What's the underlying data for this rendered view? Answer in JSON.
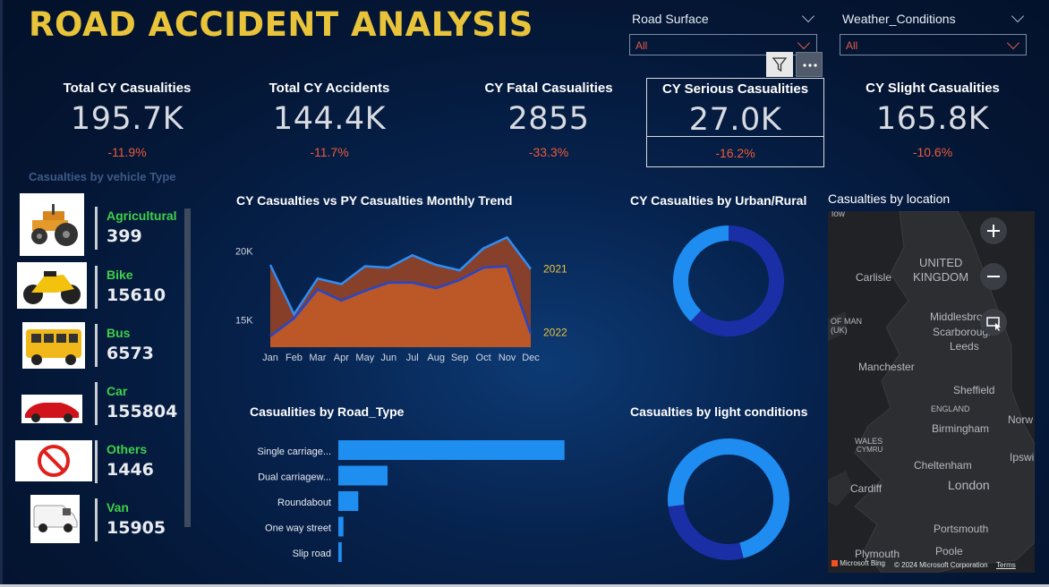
{
  "title": "ROAD ACCIDENT ANALYSIS",
  "slicers": [
    {
      "label": "Road Surface",
      "value": "All"
    },
    {
      "label": "Weather_Conditions",
      "value": "All"
    }
  ],
  "kpis": [
    {
      "title": "Total CY Casualities",
      "value": "195.7K",
      "change": "-11.9%"
    },
    {
      "title": "Total CY Accidents",
      "value": "144.4K",
      "change": "-11.7%"
    },
    {
      "title": "CY Fatal Casualities",
      "value": "2855",
      "change": "-33.3%"
    },
    {
      "title": "CY Serious Casualities",
      "value": "27.0K",
      "change": "-16.2%"
    },
    {
      "title": "CY Slight Casualities",
      "value": "165.8K",
      "change": "-10.6%"
    }
  ],
  "vehicles": {
    "title": "Casualties by vehicle Type",
    "items": [
      {
        "name": "Agricultural",
        "value": "399"
      },
      {
        "name": "Bike",
        "value": "15610"
      },
      {
        "name": "Bus",
        "value": "6573"
      },
      {
        "name": "Car",
        "value": "155804"
      },
      {
        "name": "Others",
        "value": "1446"
      },
      {
        "name": "Van",
        "value": "15905"
      }
    ]
  },
  "trend_title": "CY Casualties vs PY Casualties Monthly Trend",
  "urban_title": "CY Casualties by Urban/Rural",
  "road_title": "Casualities by Road_Type",
  "light_title": "Casualties by light conditions",
  "map": {
    "title": "Casualties by location",
    "labels": [
      "UNITED",
      "KINGDOM",
      "Carlisle",
      "OF MAN",
      "(UK)",
      "Middlesbro",
      "Scarborough",
      "Leeds",
      "Manchester",
      "Sheffield",
      "ENGLAND",
      "Norw",
      "Birmingham",
      "WALES",
      "CYMRU",
      "Cheltenham",
      "Ipswi",
      "Cardiff",
      "London",
      "Portsmouth",
      "Plymouth",
      "Poole",
      "low"
    ],
    "bing": "Microsoft Bing",
    "copyright": "© 2024 Microsoft Corporation",
    "terms": "Terms"
  },
  "colors": {
    "accent": "#e9c43a",
    "positive": "#3fd04a",
    "negative": "#ee5a3a",
    "bar": "#1f8ef1"
  },
  "chart_data": [
    {
      "type": "area",
      "title": "CY Casualties vs PY Casualties Monthly Trend",
      "categories": [
        "Jan",
        "Feb",
        "Mar",
        "Apr",
        "May",
        "Jun",
        "Jul",
        "Aug",
        "Sep",
        "Oct",
        "Nov",
        "Dec"
      ],
      "series": [
        {
          "name": "2021",
          "values": [
            19000,
            15400,
            18000,
            17600,
            18900,
            18800,
            19700,
            19000,
            18600,
            20200,
            21000,
            18700
          ]
        },
        {
          "name": "2022",
          "values": [
            13800,
            15100,
            17200,
            16400,
            17100,
            17700,
            17700,
            17300,
            17900,
            18800,
            18900,
            14000
          ]
        }
      ],
      "yticks": [
        "15K",
        "20K"
      ],
      "ylim": [
        13000,
        22000
      ]
    },
    {
      "type": "pie",
      "title": "CY Casualties by Urban/Rural",
      "values": [
        62,
        38
      ]
    },
    {
      "type": "bar",
      "title": "Casualities by Road_Type",
      "categories": [
        "Single carriage...",
        "Dual carriagew...",
        "Roundabout",
        "One way street",
        "Slip road"
      ],
      "values": [
        147000,
        32000,
        13000,
        3300,
        2200
      ],
      "xlim": [
        0,
        160000
      ]
    },
    {
      "type": "pie",
      "title": "Casualties by light conditions",
      "values": [
        73,
        27
      ]
    }
  ]
}
